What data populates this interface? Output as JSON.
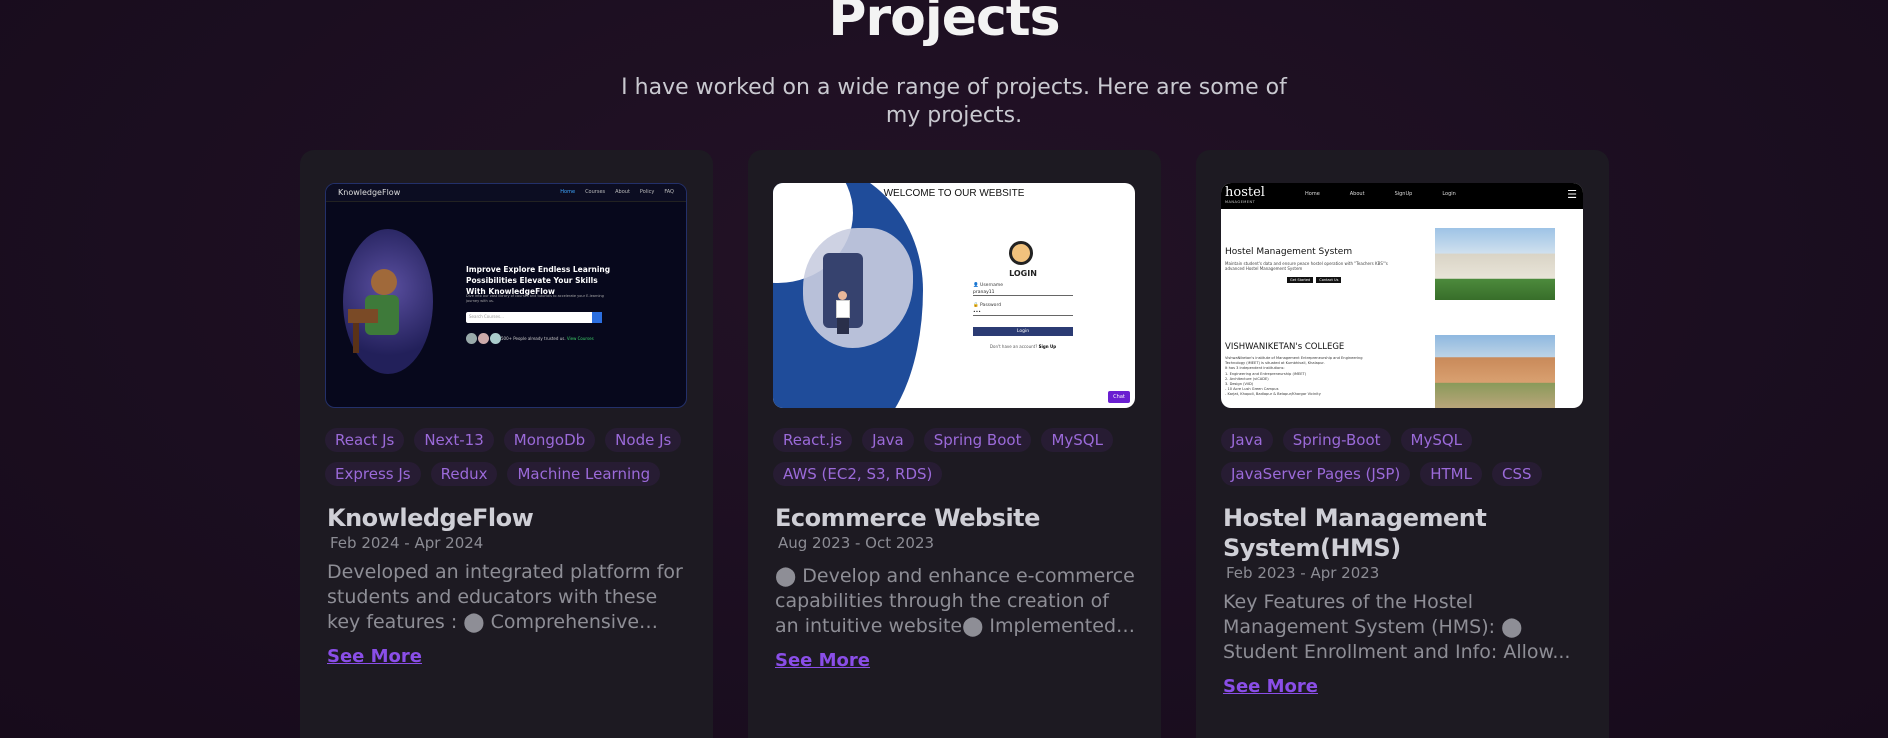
{
  "header": {
    "title": "Projects",
    "subtitle": "I have worked on a wide range of projects. Here are some of my projects."
  },
  "projects": [
    {
      "name": "KnowledgeFlow",
      "dates": "Feb 2024 - Apr 2024",
      "tags": [
        "React Js",
        "Next-13",
        "MongoDb",
        "Node Js",
        "Express Js",
        "Redux",
        "Machine Learning"
      ],
      "description": "Developed an integrated platform for students and educators with these key features : ⬤ Comprehensive LM...",
      "see_more": "See More",
      "screenshot": {
        "brand": "KnowledgeFlow",
        "nav": [
          "Home",
          "Courses",
          "About",
          "Policy",
          "FAQ"
        ],
        "headline": "Improve Explore Endless Learning Possibilities Elevate Your Skills With KnowledgeFlow",
        "subtext": "Dive into our vast library of courses and tutorials to accelerate your E-learning journey with us.",
        "search_placeholder": "Search Courses...",
        "trust": "500+ People already trusted us.",
        "trust_link": "View Courses"
      }
    },
    {
      "name": "Ecommerce Website",
      "dates": "Aug 2023 - Oct 2023",
      "tags": [
        "React.js",
        "Java",
        "Spring Boot",
        "MySQL",
        "AWS (EC2, S3, RDS)"
      ],
      "description": "⬤ Develop and enhance e-commerce capabilities through the creation of an intuitive website⬤ Implemented ...",
      "see_more": "See More",
      "screenshot": {
        "heading": "WELCOME TO OUR WEBSITE",
        "login_title": "LOGIN",
        "username_label": "Username",
        "username_value": "pranay11",
        "password_label": "Password",
        "password_value": "•••",
        "login_button": "Login",
        "signup_text": "Don't have an account?",
        "signup_link": "Sign Up",
        "chat_label": "Chat"
      }
    },
    {
      "name": "Hostel Management System(HMS)",
      "dates": "Feb 2023 - Apr 2023",
      "tags": [
        "Java",
        "Spring-Boot",
        "MySQL",
        "JavaServer Pages (JSP)",
        "HTML",
        "CSS"
      ],
      "description": "Key Features of the Hostel Management System (HMS): ⬤ Student Enrollment and Info: Allow...",
      "see_more": "See More",
      "screenshot": {
        "logo": "hostel",
        "logo_sub": "MANAGEMENT",
        "nav": [
          "Home",
          "About",
          "SignUp",
          "Login"
        ],
        "hero_title": "Hostel Management System",
        "hero_text": "Maintain student's data and ensure peace hostel operation with \"Teachers KBS\"'s advanced Hostel Management System",
        "btn1": "Get Started",
        "btn2": "Contact Us",
        "college_title": "VISHWANIKETAN's COLLEGE",
        "college_lines": [
          "VishwaNiketan's institute of Management Entrepreneurship and Engineering",
          "Technology (iMEET) is situated at Kumbhivali, Khalapur.",
          "It has 3 independent institutions:",
          "1. Engineering and Entrepreneurship (iMEET)",
          "2. Architecture (viCADE)",
          "3. Design (ViID)",
          "- 10 Acre Lush Green Campus",
          "- Karjat, Khopoli, Badlapur & Belapur/Khargar Vicinity"
        ]
      }
    }
  ]
}
